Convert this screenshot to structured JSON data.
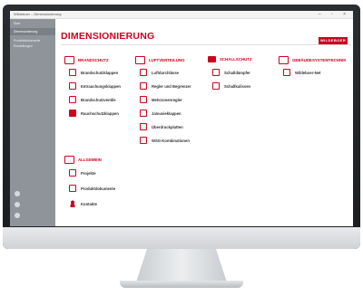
{
  "window": {
    "title": "Wildeboer – Dimensionierung",
    "controls": "– ▫ ×"
  },
  "sidebar": {
    "items": [
      {
        "label": "Start"
      },
      {
        "label": "Dimensionierung"
      },
      {
        "label": "Produktdokumente"
      },
      {
        "label": "Einstellungen"
      }
    ]
  },
  "header": {
    "title": "DIMENSIONIERUNG",
    "logo": "WILDEBOER"
  },
  "categories": {
    "brandschutz": {
      "title": "BRANDSCHUTZ",
      "items": [
        "Brandschutzklappen",
        "Entrauchungsklappen",
        "Brandschutzventile",
        "Rauchschutzklappen"
      ]
    },
    "luftverteilung": {
      "title": "LUFTVERTEILUNG",
      "items": [
        "Luftdurchlässe",
        "Regler und Begrenzer",
        "Mehrzonenregler",
        "Jalousieklappen",
        "Überdruckplatten",
        "WSG-Kombinationen"
      ]
    },
    "schallschutz": {
      "title": "SCHALLSCHUTZ",
      "items": [
        "Schalldämpfer",
        "Schallkulissen"
      ]
    },
    "gebaeude": {
      "title": "GEBÄUDESYSTEMTECHNIK",
      "items": [
        "Wildeboer-Net"
      ]
    },
    "allgemein": {
      "title": "ALLGEMEIN",
      "items": [
        "Projekte",
        "Produktdokumente",
        "Kontakte"
      ]
    }
  },
  "colors": {
    "accent": "#d0021b",
    "sidebar": "#8f949b"
  }
}
